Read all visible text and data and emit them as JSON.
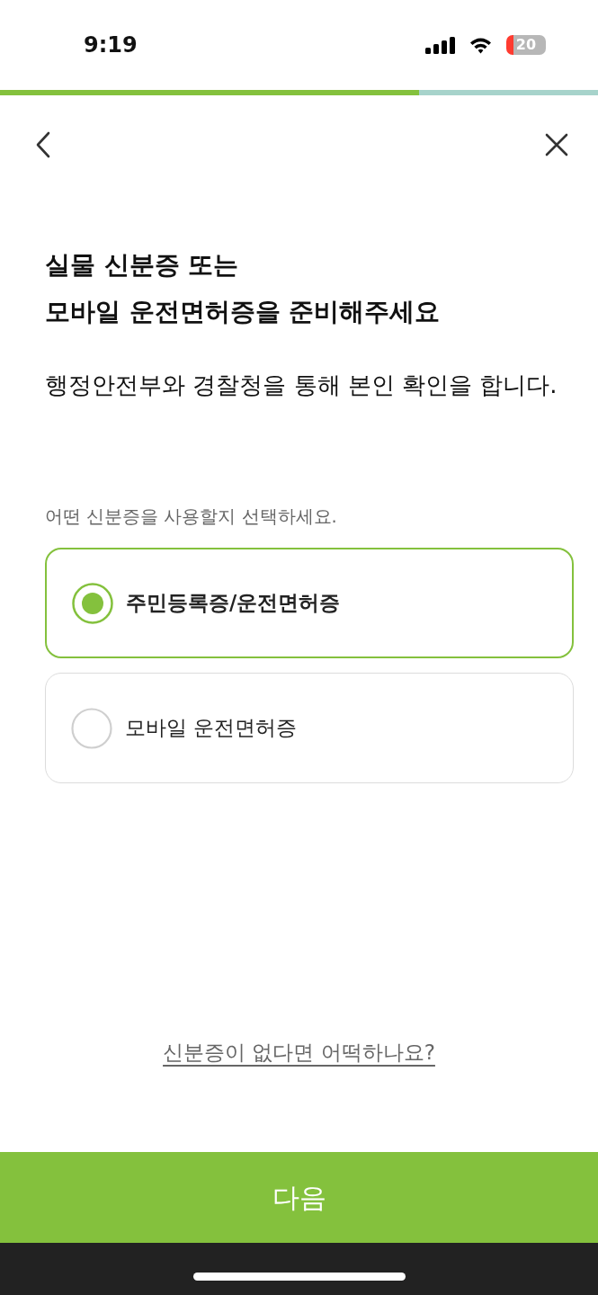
{
  "status_bar": {
    "time": "9:19",
    "battery": "20"
  },
  "progress": {
    "level": 0.7
  },
  "title": "실물 신분증 또는\n모바일 운전면허증을 준비해주세요",
  "subtitle": "행정안전부와 경찰청을 통해 본인 확인을 합니다.",
  "prompt": "어떤 신분증을 사용할지 선택하세요.",
  "options": [
    {
      "label": "주민등록증/운전면허증",
      "selected": true
    },
    {
      "label": "모바일 운전면허증",
      "selected": false
    }
  ],
  "help_link": "신분증이 없다면 어떡하나요?",
  "next_button": "다음"
}
